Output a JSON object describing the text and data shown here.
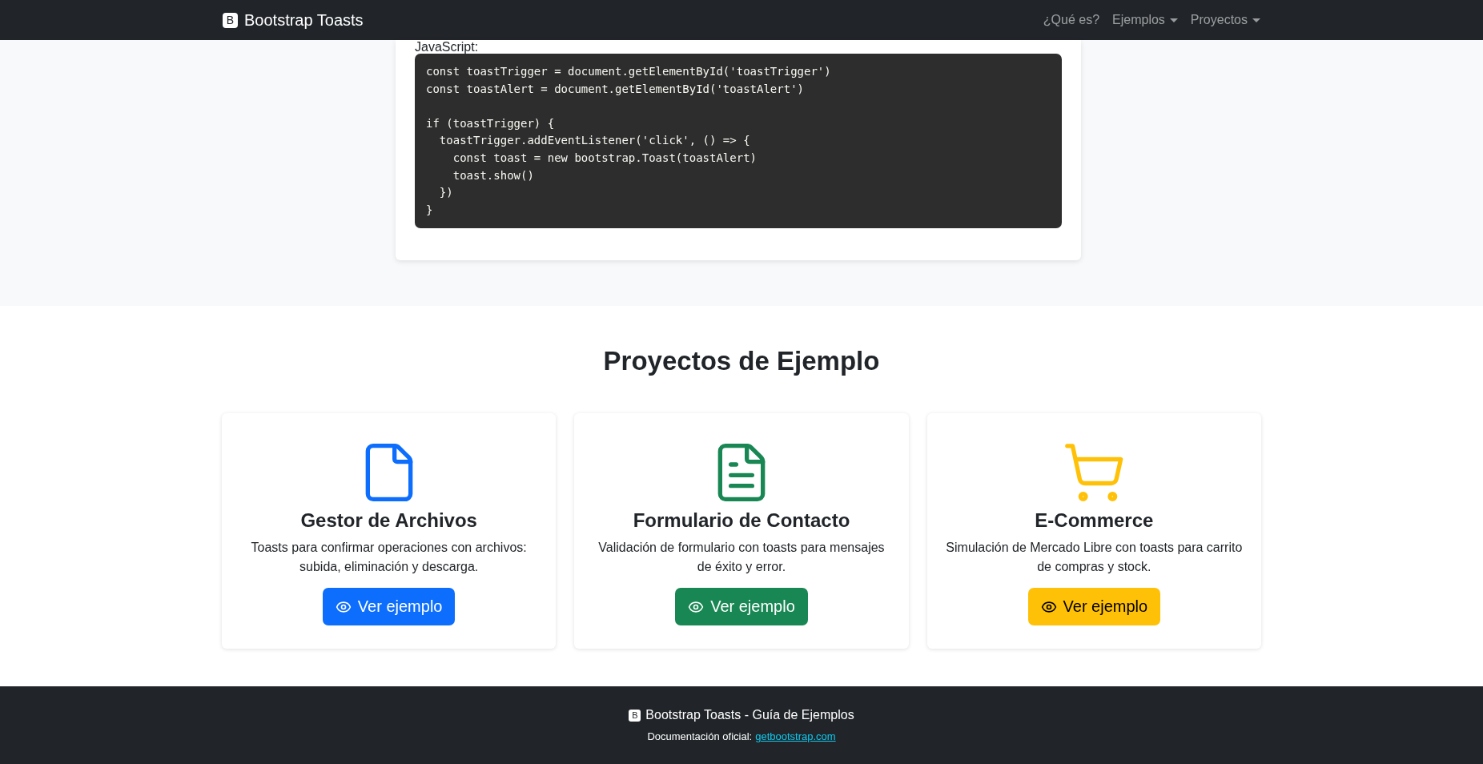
{
  "navbar": {
    "brand_icon": "B",
    "brand": "Bootstrap Toasts",
    "links": [
      {
        "label": "¿Qué es?",
        "dropdown": false
      },
      {
        "label": "Ejemplos",
        "dropdown": true
      },
      {
        "label": "Proyectos",
        "dropdown": true
      }
    ]
  },
  "code_section": {
    "label": "JavaScript:",
    "code": "const toastTrigger = document.getElementById('toastTrigger')\nconst toastAlert = document.getElementById('toastAlert')\n\nif (toastTrigger) {\n  toastTrigger.addEventListener('click', () => {\n    const toast = new bootstrap.Toast(toastAlert)\n    toast.show()\n  })\n}"
  },
  "projects": {
    "title": "Proyectos de Ejemplo",
    "cards": [
      {
        "kind": "file",
        "color": "#0d6efd",
        "title": "Gestor de Archivos",
        "description": "Toasts para confirmar operaciones con archivos: subida, eliminación y descarga.",
        "button": "Ver ejemplo"
      },
      {
        "kind": "document",
        "color": "#198754",
        "title": "Formulario de Contacto",
        "description": "Validación de formulario con toasts para mensajes de éxito y error.",
        "button": "Ver ejemplo"
      },
      {
        "kind": "cart",
        "color": "#ffc107",
        "title": "E-Commerce",
        "description": "Simulación de Mercado Libre con toasts para carrito de compras y stock.",
        "button": "Ver ejemplo"
      }
    ]
  },
  "footer": {
    "brand_icon": "B",
    "title": "Bootstrap Toasts - Guía de Ejemplos",
    "doc_label": "Documentación oficial:",
    "doc_link": "getbootstrap.com"
  }
}
